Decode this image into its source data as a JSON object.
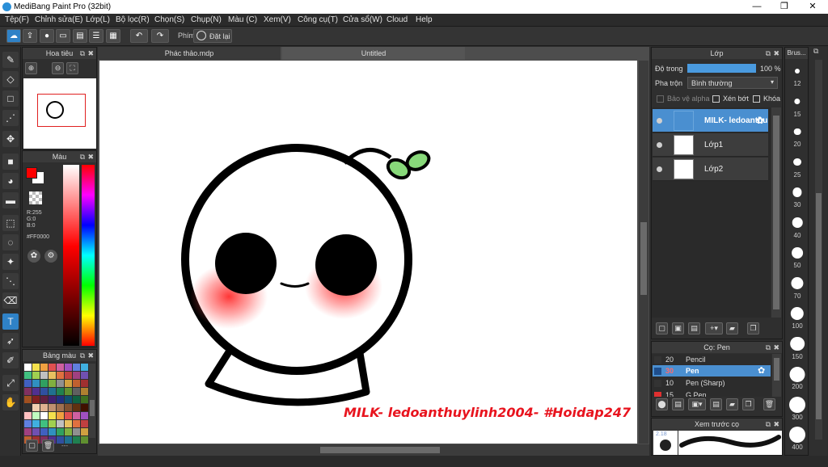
{
  "window": {
    "title": "MediBang Paint Pro (32bit)",
    "minimize": "—",
    "maximize": "❐",
    "close": "✕"
  },
  "menu": [
    "Tệp(F)",
    "Chỉnh sửa(E)",
    "Lớp(L)",
    "Bộ lọc(R)",
    "Chọn(S)",
    "Chụp(N)",
    "Màu (C)",
    "Xem(V)",
    "Công cụ(T)",
    "Cửa sổ(W)",
    "Cloud",
    "Help"
  ],
  "toolbar": {
    "shortcut_label": "Phím",
    "reset_label": "Đặt lại"
  },
  "navigator": {
    "title": "Hoa tiêu"
  },
  "color_panel": {
    "title": "Màu",
    "r": "R:255",
    "g": "G:0",
    "b": "B:0",
    "hex": "#FF0000",
    "fg": "#ff0000",
    "bg": "#ffffff"
  },
  "palette": {
    "title": "Bảng màu",
    "more": "---"
  },
  "tabs": [
    "Phác thảo.mdp",
    "Untitled"
  ],
  "canvas": {
    "watermark": "MILK- ledoanthuylinh2004- #Hoidap247"
  },
  "layer_panel": {
    "title": "Lớp",
    "opacity_label": "Độ trong",
    "opacity_value": "100 %",
    "opacity": 1.0,
    "blend_label": "Pha trộn",
    "blend_value": "Bình thường",
    "protect_alpha": "Bảo vệ alpha",
    "clipping": "Xén bớt",
    "lock": "Khóa",
    "layers": [
      {
        "name": "MILK- ledoanthu",
        "selected": true
      },
      {
        "name": "Lớp1",
        "selected": false
      },
      {
        "name": "Lớp2",
        "selected": false
      }
    ]
  },
  "brush_panel": {
    "title": "Cọ: Pen",
    "brushes": [
      {
        "size": "20",
        "name": "Pencil",
        "color": "#333333",
        "selected": false
      },
      {
        "size": "30",
        "name": "Pen",
        "color": "#1f4e8c",
        "selected": true
      },
      {
        "size": "10",
        "name": "Pen (Sharp)",
        "color": "#333333",
        "selected": false
      },
      {
        "size": "15",
        "name": "G Pen",
        "color": "#e03030",
        "selected": false
      }
    ]
  },
  "preview_panel": {
    "title": "Xem trước cọ",
    "size": "2.18"
  },
  "brush_size_panel": {
    "title": "Brus...",
    "sizes": [
      "12",
      "15",
      "20",
      "25",
      "30",
      "40",
      "50",
      "70",
      "100",
      "150",
      "200",
      "300",
      "400"
    ]
  },
  "colors": {
    "accent": "#4a8fd0",
    "panel_bg": "#2f2f2f",
    "watermark": "#e8141e",
    "sprout": "#88d97a"
  }
}
